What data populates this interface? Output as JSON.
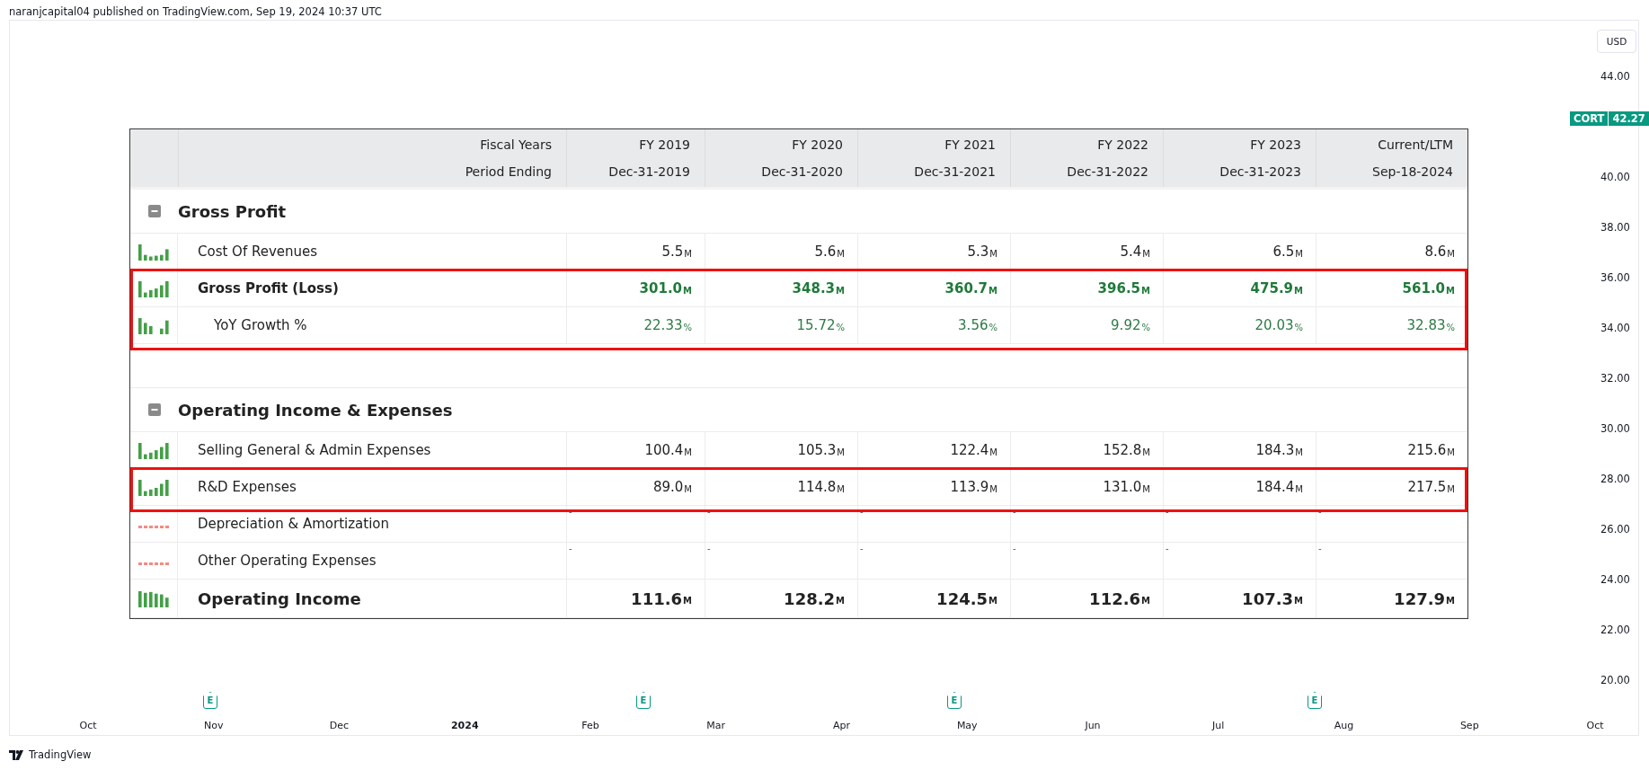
{
  "header": {
    "text": "naranjcapital04 published on TradingView.com, Sep 19, 2024 10:37 UTC"
  },
  "price_axis": {
    "currency": "USD",
    "labels": [
      "44.00",
      "40.00",
      "38.00",
      "36.00",
      "34.00",
      "32.00",
      "30.00",
      "28.00",
      "26.00",
      "24.00",
      "22.00",
      "20.00"
    ],
    "price_tag": {
      "symbol": "CORT",
      "price": "42.27"
    }
  },
  "time_axis": {
    "labels": [
      {
        "text": "Oct",
        "bold": false
      },
      {
        "text": "Nov",
        "bold": false
      },
      {
        "text": "Dec",
        "bold": false
      },
      {
        "text": "2024",
        "bold": true
      },
      {
        "text": "Feb",
        "bold": false
      },
      {
        "text": "Mar",
        "bold": false
      },
      {
        "text": "Apr",
        "bold": false
      },
      {
        "text": "May",
        "bold": false
      },
      {
        "text": "Jun",
        "bold": false
      },
      {
        "text": "Jul",
        "bold": false
      },
      {
        "text": "Aug",
        "bold": false
      },
      {
        "text": "Sep",
        "bold": false
      },
      {
        "text": "Oct",
        "bold": false
      }
    ]
  },
  "earnings_markers": [
    {
      "label": "E"
    },
    {
      "label": "E"
    },
    {
      "label": "E"
    },
    {
      "label": "E"
    }
  ],
  "table": {
    "header_rows": [
      {
        "label": "Fiscal Years",
        "values": [
          "FY 2019",
          "FY 2020",
          "FY 2021",
          "FY 2022",
          "FY 2023",
          "Current/LTM"
        ]
      },
      {
        "label": "Period Ending",
        "values": [
          "Dec-31-2019",
          "Dec-31-2020",
          "Dec-31-2021",
          "Dec-31-2022",
          "Dec-31-2023",
          "Sep-18-2024"
        ]
      }
    ],
    "rows": [
      {
        "kind": "section",
        "label": "Gross Profit",
        "expanded": true
      },
      {
        "kind": "item",
        "label": "Cost Of Revenues",
        "trend_available": true,
        "highlighted": false,
        "values": [
          {
            "value": "5.5",
            "unit": "M"
          },
          {
            "value": "5.6",
            "unit": "M"
          },
          {
            "value": "5.3",
            "unit": "M"
          },
          {
            "value": "5.4",
            "unit": "M"
          },
          {
            "value": "6.5",
            "unit": "M"
          },
          {
            "value": "8.6",
            "unit": "M"
          }
        ]
      },
      {
        "kind": "key",
        "label": "Gross Profit (Loss)",
        "trend_available": true,
        "highlighted": true,
        "values": [
          {
            "value": "301.0",
            "unit": "M"
          },
          {
            "value": "348.3",
            "unit": "M"
          },
          {
            "value": "360.7",
            "unit": "M"
          },
          {
            "value": "396.5",
            "unit": "M"
          },
          {
            "value": "475.9",
            "unit": "M"
          },
          {
            "value": "561.0",
            "unit": "M"
          }
        ]
      },
      {
        "kind": "growth",
        "label": "YoY Growth %",
        "trend_available": true,
        "highlighted": true,
        "values": [
          {
            "value": "22.33",
            "unit": "%"
          },
          {
            "value": "15.72",
            "unit": "%"
          },
          {
            "value": "3.56",
            "unit": "%"
          },
          {
            "value": "9.92",
            "unit": "%"
          },
          {
            "value": "20.03",
            "unit": "%"
          },
          {
            "value": "32.83",
            "unit": "%"
          }
        ]
      },
      {
        "kind": "spacer"
      },
      {
        "kind": "section",
        "label": "Operating Income & Expenses",
        "expanded": true
      },
      {
        "kind": "item",
        "label": "Selling General & Admin Expenses",
        "trend_available": true,
        "highlighted": false,
        "values": [
          {
            "value": "100.4",
            "unit": "M"
          },
          {
            "value": "105.3",
            "unit": "M"
          },
          {
            "value": "122.4",
            "unit": "M"
          },
          {
            "value": "152.8",
            "unit": "M"
          },
          {
            "value": "184.3",
            "unit": "M"
          },
          {
            "value": "215.6",
            "unit": "M"
          }
        ]
      },
      {
        "kind": "item",
        "label": "R&D Expenses",
        "trend_available": true,
        "highlighted": true,
        "values": [
          {
            "value": "89.0",
            "unit": "M"
          },
          {
            "value": "114.8",
            "unit": "M"
          },
          {
            "value": "113.9",
            "unit": "M"
          },
          {
            "value": "131.0",
            "unit": "M"
          },
          {
            "value": "184.4",
            "unit": "M"
          },
          {
            "value": "217.5",
            "unit": "M"
          }
        ]
      },
      {
        "kind": "item",
        "label": "Depreciation & Amortization",
        "trend_available": false,
        "highlighted": false,
        "values": [
          {
            "value": "-"
          },
          {
            "value": "-"
          },
          {
            "value": "-"
          },
          {
            "value": "-"
          },
          {
            "value": "-"
          },
          {
            "value": "-"
          }
        ]
      },
      {
        "kind": "item",
        "label": "Other Operating Expenses",
        "trend_available": false,
        "highlighted": false,
        "values": [
          {
            "value": "-"
          },
          {
            "value": "-"
          },
          {
            "value": "-"
          },
          {
            "value": "-"
          },
          {
            "value": "-"
          },
          {
            "value": "-"
          }
        ]
      },
      {
        "kind": "total",
        "label": "Operating Income",
        "trend_available": true,
        "highlighted": false,
        "values": [
          {
            "value": "111.6",
            "unit": "M"
          },
          {
            "value": "128.2",
            "unit": "M"
          },
          {
            "value": "124.5",
            "unit": "M"
          },
          {
            "value": "112.6",
            "unit": "M"
          },
          {
            "value": "107.3",
            "unit": "M"
          },
          {
            "value": "127.9",
            "unit": "M"
          }
        ]
      }
    ]
  },
  "footer": {
    "brand": "TradingView"
  }
}
